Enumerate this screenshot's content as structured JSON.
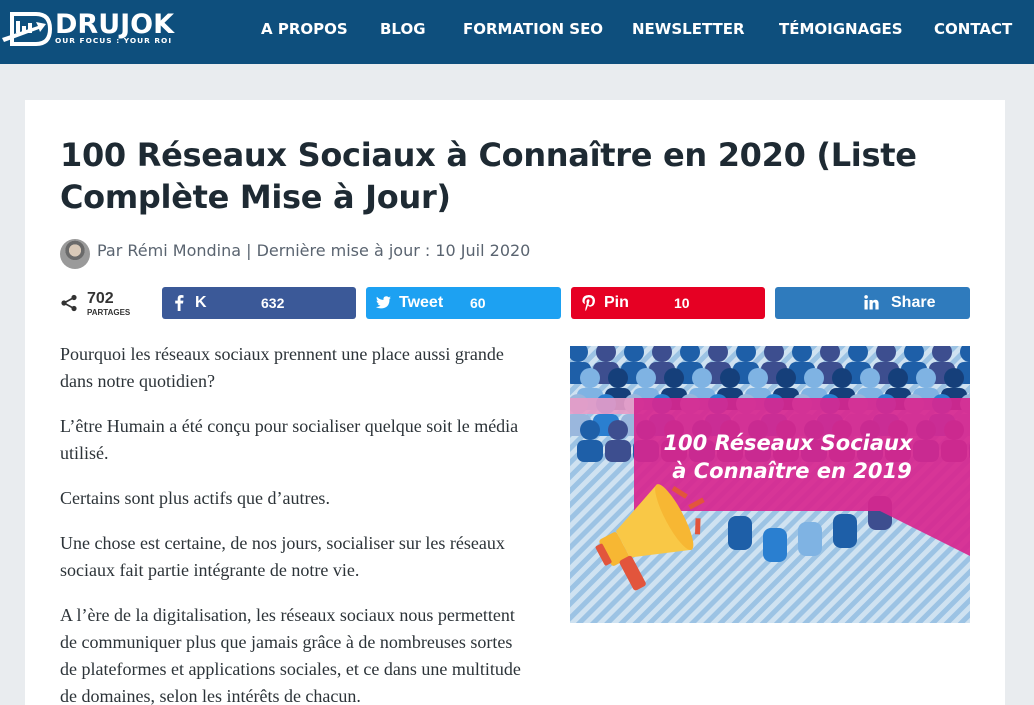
{
  "header": {
    "logo_name": "DRUJOK",
    "logo_tagline": "OUR FOCUS : YOUR ROI",
    "nav": [
      "A PROPOS",
      "BLOG",
      "FORMATION SEO",
      "NEWSLETTER",
      "TÉMOIGNAGES",
      "CONTACT"
    ]
  },
  "article": {
    "title": "100 Réseaux Sociaux à Connaître en 2020 (Liste Complète Mise à Jour)",
    "byline": "Par Rémi Mondina |  Dernière mise à jour : 10 Juil 2020",
    "share": {
      "total": "702",
      "total_label": "PARTAGES",
      "buttons": [
        {
          "network": "facebook",
          "label": "K",
          "count": "632",
          "color": "#3b5998"
        },
        {
          "network": "twitter",
          "label": "Tweet",
          "count": "60",
          "color": "#1da1f2"
        },
        {
          "network": "pinterest",
          "label": "Pin",
          "count": "10",
          "color": "#e60023"
        },
        {
          "network": "linkedin",
          "label": "Share",
          "count": "",
          "color": "#2f7bbd"
        }
      ]
    },
    "paragraphs": [
      "Pourquoi les réseaux sociaux prennent une place aussi grande dans notre quotidien?",
      "L’être Humain a été conçu pour socialiser quelque soit le média utilisé.",
      "Certains sont plus actifs que d’autres.",
      "Une chose est certaine, de nos jours, socialiser sur les réseaux sociaux fait partie intégrante de notre vie.",
      "A l’ère de la digitalisation, les réseaux sociaux nous permettent de communiquer plus que jamais grâce à de nombreuses sortes de plateformes et applications sociales, et ce dans une multitude de domaines, selon les intérêts de chacun."
    ],
    "hero_image": {
      "line1": "100 Réseaux Sociaux",
      "line2": "à Connaître en 2019",
      "icon": "megaphone-icon"
    }
  },
  "colors": {
    "header_bg": "#0e4f7d",
    "page_bg": "#e9ecef",
    "title": "#1e2a33",
    "banner_magenta": "#d8268f"
  }
}
